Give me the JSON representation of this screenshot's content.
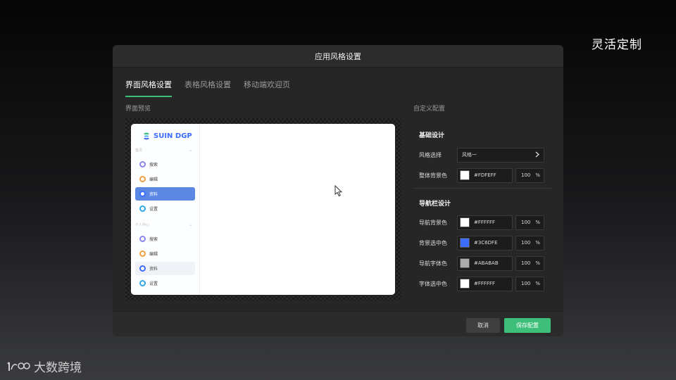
{
  "corner_title": "灵活定制",
  "brand": {
    "text": "大数跨境"
  },
  "dialog": {
    "title": "应用风格设置",
    "tabs": [
      {
        "label": "界面风格设置",
        "active": true
      },
      {
        "label": "表格风格设置",
        "active": false
      },
      {
        "label": "移动端欢迎页",
        "active": false
      }
    ],
    "preview_label": "界面预览",
    "config_label": "自定义配置",
    "preview": {
      "logo_text": "SUIN DGP",
      "groups": [
        {
          "label": "首页",
          "items": [
            {
              "label": "搜索",
              "icon": "search-icon",
              "state": "normal"
            },
            {
              "label": "编辑",
              "icon": "edit-icon",
              "state": "normal"
            },
            {
              "label": "资料",
              "icon": "document-icon",
              "state": "selected"
            },
            {
              "label": "设置",
              "icon": "settings-icon",
              "state": "normal"
            }
          ]
        },
        {
          "label": "个人中心",
          "items": [
            {
              "label": "搜索",
              "icon": "search-icon",
              "state": "normal"
            },
            {
              "label": "编辑",
              "icon": "edit-icon",
              "state": "normal"
            },
            {
              "label": "资料",
              "icon": "document-icon",
              "state": "hover"
            },
            {
              "label": "设置",
              "icon": "settings-icon",
              "state": "normal"
            }
          ]
        }
      ]
    },
    "basic": {
      "title": "基础设计",
      "style_select": {
        "label": "风格选择",
        "value": "风格一"
      },
      "bg": {
        "label": "整体背景色",
        "color": "#FDFEFF",
        "opacity": "100",
        "unit": "%"
      }
    },
    "nav": {
      "title": "导航栏设计",
      "rows": [
        {
          "label": "导航背景色",
          "color": "#FFFFFF",
          "opacity": "100",
          "unit": "%"
        },
        {
          "label": "背景选中色",
          "color": "#3C6DFE",
          "opacity": "100",
          "unit": "%"
        },
        {
          "label": "导航字体色",
          "color": "#ABABAB",
          "opacity": "100",
          "unit": "%"
        },
        {
          "label": "字体选中色",
          "color": "#FFFFFF",
          "opacity": "100",
          "unit": "%"
        }
      ]
    },
    "buttons": {
      "cancel": "取消",
      "save": "保存配置"
    }
  }
}
